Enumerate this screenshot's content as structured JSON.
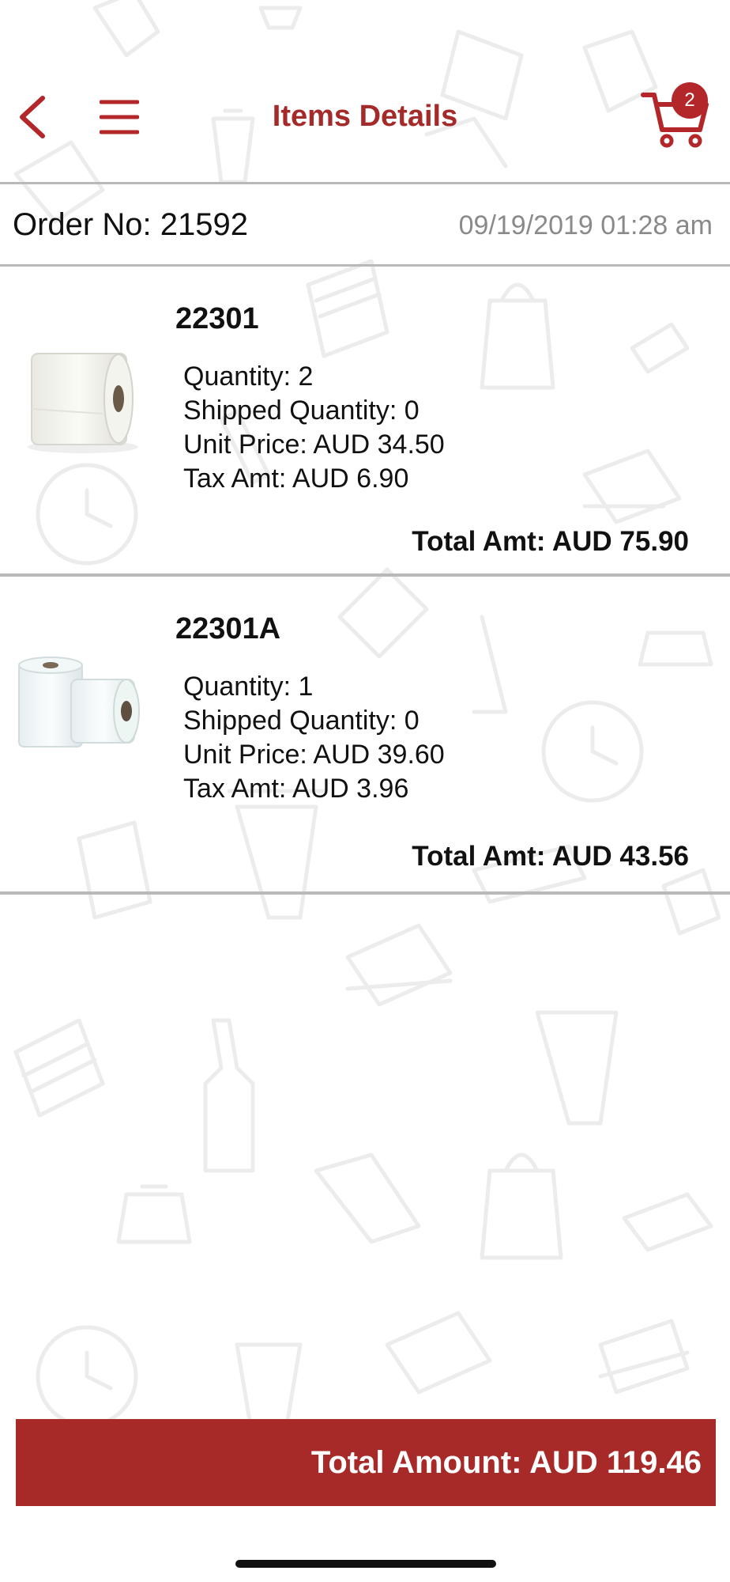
{
  "header": {
    "title": "Items Details",
    "cart_count": "2",
    "accent_color": "#a52a2a"
  },
  "order": {
    "number_label": "Order No: 21592",
    "datetime": "09/19/2019 01:28 am"
  },
  "items": [
    {
      "code": "22301",
      "quantity": "Quantity:  2",
      "shipped": "Shipped Quantity: 0",
      "unit_price": "Unit Price: AUD 34.50",
      "tax": "Tax Amt: AUD 6.90",
      "total": "Total Amt: AUD 75.90",
      "image": "paper-towel-roll"
    },
    {
      "code": "22301A",
      "quantity": "Quantity:  1",
      "shipped": "Shipped Quantity: 0",
      "unit_price": "Unit Price: AUD 39.60",
      "tax": "Tax Amt: AUD 3.96",
      "total": "Total Amt: AUD 43.56",
      "image": "paper-towel-rolls-pair"
    }
  ],
  "footer": {
    "total_amount": "Total Amount: AUD 119.46",
    "bar_color": "#a72a29"
  },
  "icons": {
    "back": "chevron-left-icon",
    "menu": "hamburger-menu-icon",
    "cart": "shopping-cart-icon"
  }
}
